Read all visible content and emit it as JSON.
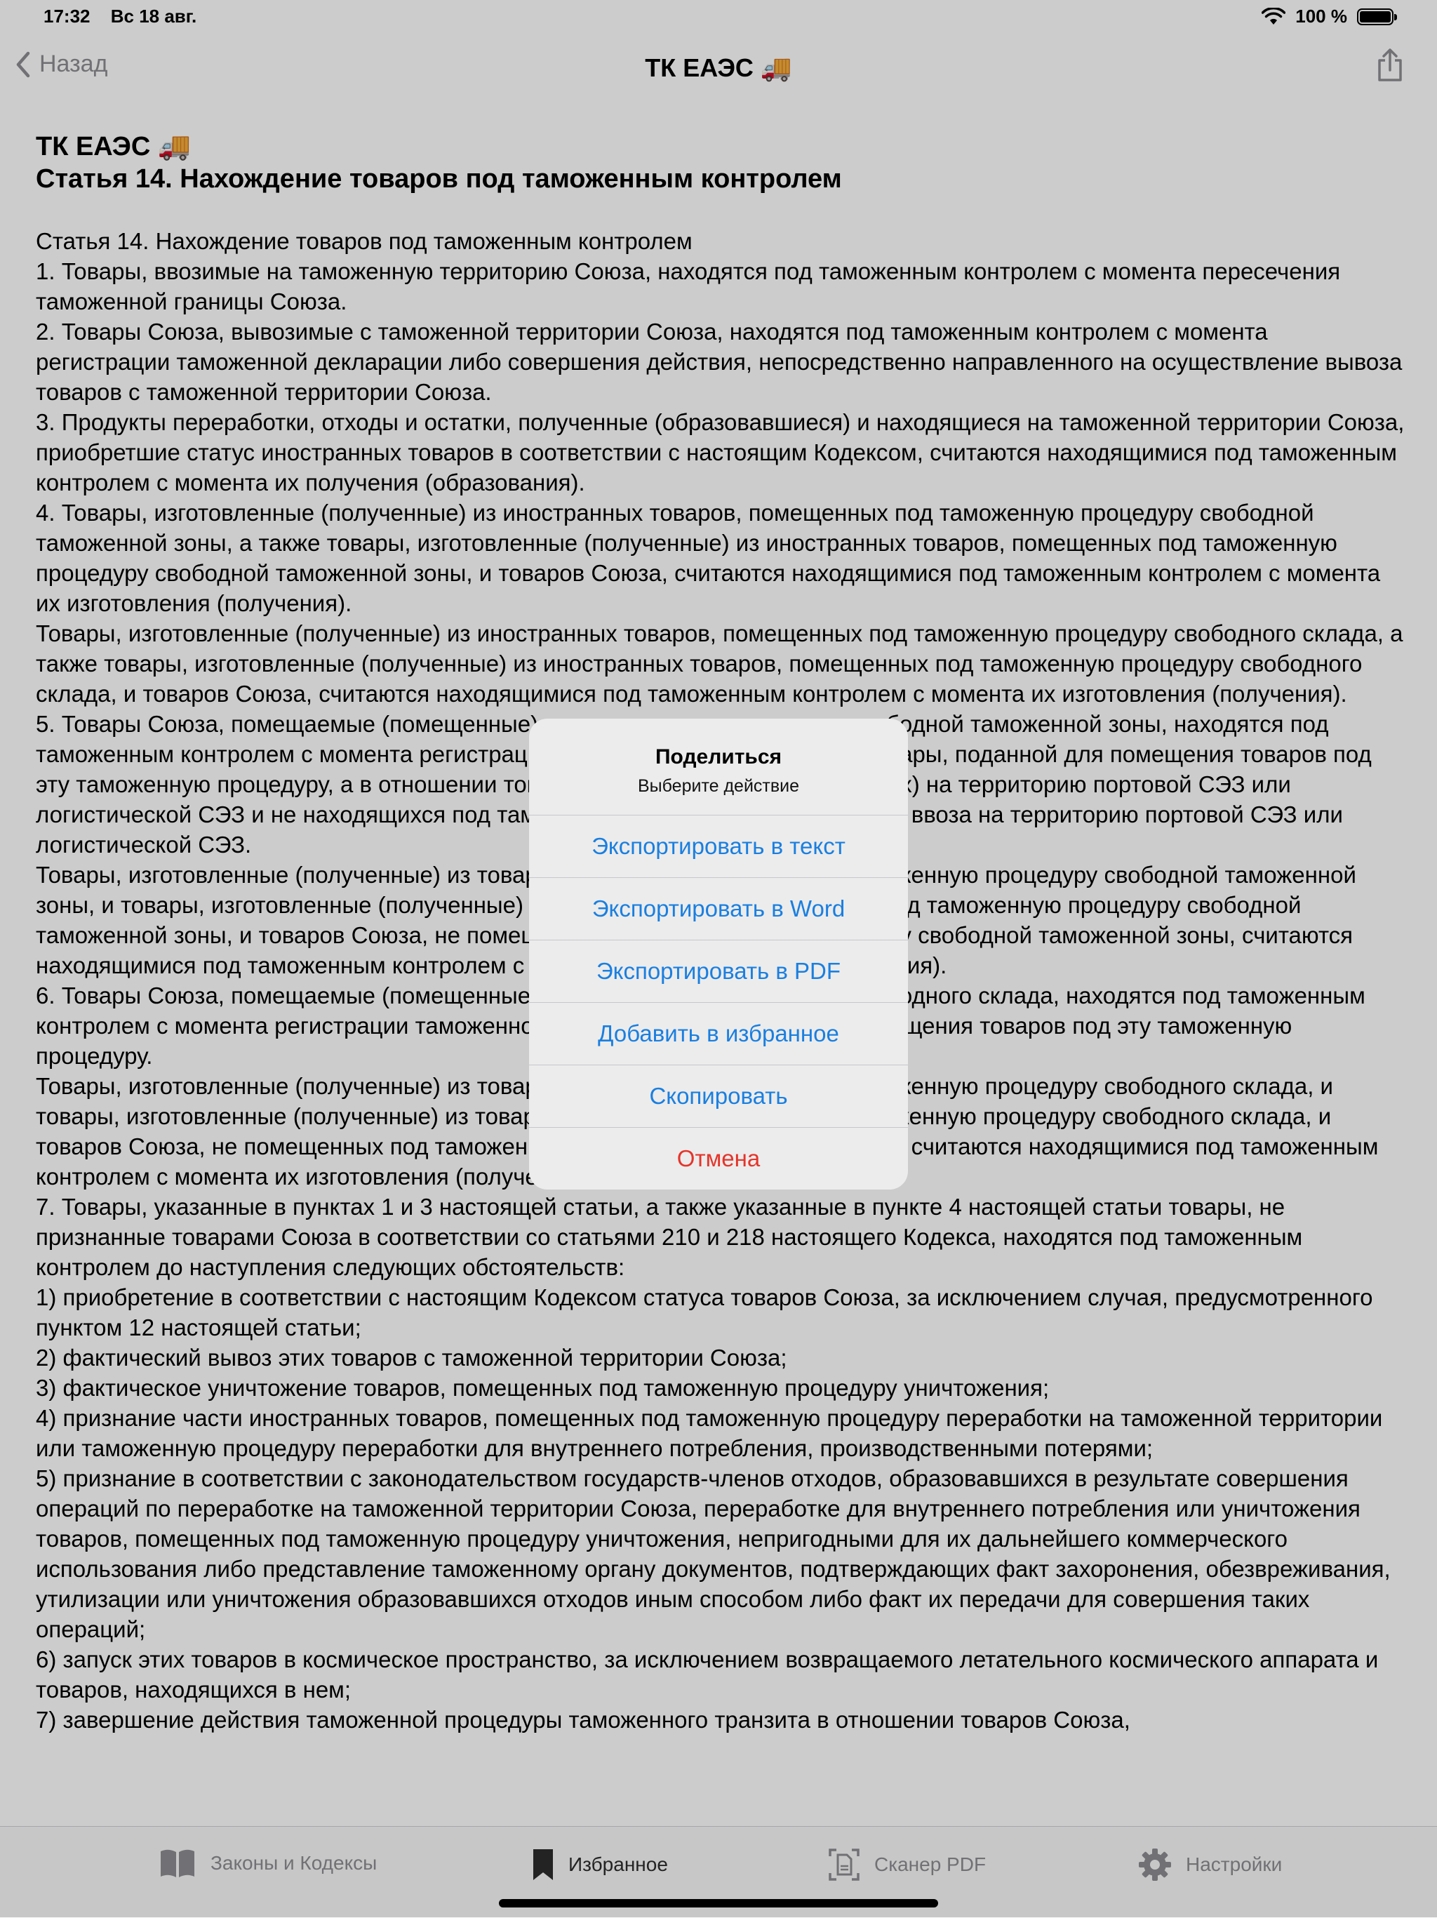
{
  "status_bar": {
    "time": "17:32",
    "date": "Вс 18 авг.",
    "battery": "100 %"
  },
  "nav": {
    "back_label": "Назад",
    "title": "ТК ЕАЭС 🚚"
  },
  "article": {
    "title_line1": "ТК ЕАЭС 🚚",
    "title_line2": "Статья 14. Нахождение товаров под таможенным контролем",
    "paragraphs": [
      "Статья 14. Нахождение товаров под таможенным контролем",
      "1. Товары, ввозимые на таможенную территорию Союза, находятся под таможенным контролем с момента пересечения таможенной границы Союза.",
      "2. Товары Союза, вывозимые с таможенной территории Союза, находятся под таможенным контролем с момента регистрации таможенной декларации либо совершения действия, непосредственно направленного на осуществление вывоза товаров с таможенной территории Союза.",
      "3. Продукты переработки, отходы и остатки, полученные (образовавшиеся) и находящиеся на таможенной территории Союза, приобретшие статус иностранных товаров в соответствии с настоящим Кодексом, считаются находящимися под таможенным контролем с момента их получения (образования).",
      "4. Товары, изготовленные (полученные) из иностранных товаров, помещенных под таможенную процедуру свободной таможенной зоны, а также товары, изготовленные (полученные) из иностранных товаров, помещенных под таможенную процедуру свободной таможенной зоны, и товаров Союза, считаются находящимися под таможенным контролем с момента их изготовления (получения).",
      "Товары, изготовленные (полученные) из иностранных товаров, помещенных под таможенную процедуру свободного склада, а также товары, изготовленные (полученные) из иностранных товаров, помещенных под таможенную процедуру свободного склада, и товаров Союза, считаются находящимися под таможенным контролем с момента их изготовления (получения).",
      "5. Товары Союза, помещаемые (помещенные) под таможенную процедуру свободной таможенной зоны, находятся под таможенным контролем с момента регистрации таможенной декларации на товары, поданной для помещения товаров под эту таможенную процедуру, а в отношении товаров Союза, ввозимых (ввезенных) на территорию портовой СЭЗ или логистической СЭЗ и не находящихся под таможенным контролем с момента их ввоза на территорию портовой СЭЗ или логистической СЭЗ.",
      "Товары, изготовленные (полученные) из товаров Союза, помещенных под таможенную процедуру свободной таможенной зоны, и товары, изготовленные (полученные) из товаров Союза, помещенных под таможенную процедуру свободной таможенной зоны, и товаров Союза, не помещенных под таможенную процедуру свободной таможенной зоны, считаются находящимися под таможенным контролем с момента их изготовления (получения).",
      "6. Товары Союза, помещаемые (помещенные) под таможенную процедуру свободного склада, находятся под таможенным контролем с момента регистрации таможенной декларации, поданной для помещения товаров под эту таможенную процедуру.",
      "Товары, изготовленные (полученные) из товаров Союза, помещенных под таможенную процедуру свободного склада, и товары, изготовленные (полученные) из товаров Союза, помещенных под таможенную процедуру свободного склада, и товаров Союза, не помещенных под таможенную процедуру свободного склада, считаются находящимися под таможенным контролем с момента их изготовления (получения).",
      "7. Товары, указанные в пунктах 1 и 3 настоящей статьи, а также указанные в пункте 4 настоящей статьи товары, не признанные товарами Союза в соответствии со статьями 210 и 218 настоящего Кодекса, находятся под таможенным контролем до наступления следующих обстоятельств:",
      "1) приобретение в соответствии с настоящим Кодексом статуса товаров Союза, за исключением случая, предусмотренного пунктом 12 настоящей статьи;",
      "2) фактический вывоз этих товаров с таможенной территории Союза;",
      "3) фактическое уничтожение товаров, помещенных под таможенную процедуру уничтожения;",
      "4) признание части иностранных товаров, помещенных под таможенную процедуру переработки на таможенной территории или таможенную процедуру переработки для внутреннего потребления, производственными потерями;",
      "5) признание в соответствии с законодательством государств-членов отходов, образовавшихся в результате совершения операций по переработке на таможенной территории Союза, переработке для внутреннего потребления или уничтожения товаров, помещенных под таможенную процедуру уничтожения, непригодными для их дальнейшего коммерческого использования либо представление таможенному органу документов, подтверждающих факт захоронения, обезвреживания, утилизации или уничтожения образовавшихся отходов иным способом либо факт их передачи для совершения таких операций;",
      "6) запуск этих товаров в космическое пространство, за исключением возвращаемого летательного космического аппарата и товаров, находящихся в нем;",
      "7) завершение действия таможенной процедуры таможенного транзита в отношении товаров Союза,"
    ]
  },
  "alert": {
    "title": "Поделиться",
    "message": "Выберите действие",
    "actions": [
      "Экспортировать в текст",
      "Экспортировать в Word",
      "Экспортировать в PDF",
      "Добавить в избранное",
      "Скопировать"
    ],
    "cancel": "Отмена"
  },
  "tabs": [
    {
      "label": "Законы и Кодексы",
      "icon": "book-icon"
    },
    {
      "label": "Избранное",
      "icon": "bookmark-icon"
    },
    {
      "label": "Сканер PDF",
      "icon": "doc-scanner-icon"
    },
    {
      "label": "Настройки",
      "icon": "gear-icon"
    }
  ],
  "colors": {
    "accent": "#1a7fe0",
    "destructive": "#e5342a",
    "inactive": "#8e8e93"
  }
}
